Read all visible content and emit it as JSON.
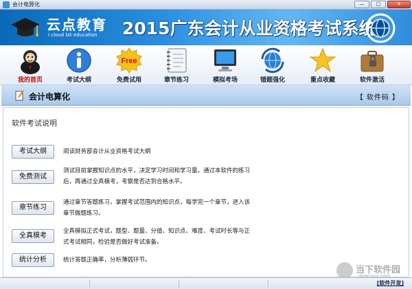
{
  "window": {
    "title": "会计电算化",
    "min_glyph": "—",
    "max_glyph": "□",
    "close_glyph": "✕"
  },
  "banner": {
    "logo_cn": "云点教育",
    "logo_en": "I cloud bit education",
    "system_title": "2015广东会计从业资格考试系统",
    "colors": {
      "start": "#0a69b8",
      "end": "#63b7f3"
    }
  },
  "toolbar": {
    "items": [
      {
        "label": "我的首页",
        "icon": "user-avatar-icon",
        "active": true
      },
      {
        "label": "考试大纲",
        "icon": "info-icon"
      },
      {
        "label": "免费试用",
        "icon": "free-badge-icon",
        "badge": "Free"
      },
      {
        "label": "章节练习",
        "icon": "notebook-icon"
      },
      {
        "label": "模拟考场",
        "icon": "monitor-icon"
      },
      {
        "label": "错题强化",
        "icon": "globe-refresh-icon"
      },
      {
        "label": "重点收藏",
        "icon": "star-icon"
      },
      {
        "label": "软件激活",
        "icon": "briefcase-lock-icon"
      }
    ]
  },
  "section": {
    "title": "会计电算化",
    "software_code": "【 软件码 】"
  },
  "panel": {
    "heading": "软件考试说明",
    "rows": [
      {
        "button": "考试大纲",
        "text": "阅读财务部会计从业资格考试大纲"
      },
      {
        "button": "免费测试",
        "text": "测试目前掌握知识点的水平，决定学习时间和学习量。通过本软件的练习后，再通过全真模考，考察是否达到合格水平。"
      },
      {
        "button": "章节练习",
        "text": "通过章节答题练习，掌握考试范围内的知识点，每学完一个章节，进入该章节做题练习。"
      },
      {
        "button": "全真模考",
        "text": "全真模拟正式考试，题型、题量、分值、知识点、难度、考试时长等与正式考试相同，检验是否做好考试准备。"
      },
      {
        "button": "统计分析",
        "text": "统计答题正确率，分析薄弱环节。"
      }
    ]
  },
  "statusbar": {
    "dev_link": "[软件开发]"
  },
  "watermark": {
    "text": "当下软件园",
    "sub": "downxia.com"
  }
}
